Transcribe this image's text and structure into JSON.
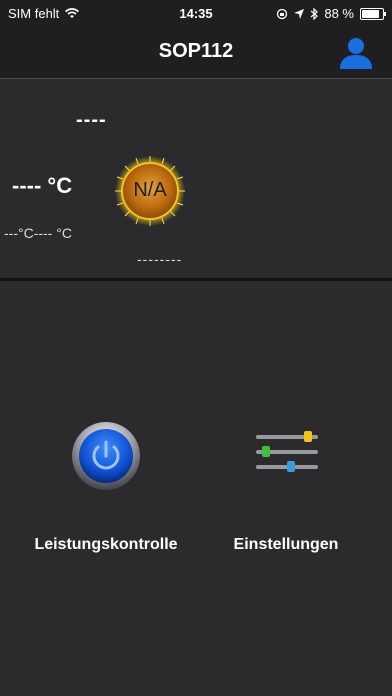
{
  "status_bar": {
    "carrier": "SIM fehlt",
    "time": "14:35",
    "battery": "88 %",
    "battery_level": 0.88
  },
  "nav": {
    "title": "SOP112",
    "user_icon": "user-icon"
  },
  "status": {
    "top_value": "----",
    "temperature": "---- °C",
    "range": "---°C---- °C",
    "bottom_value": "--------",
    "badge": "N/A"
  },
  "actions": {
    "power_label": "Leistungskontrolle",
    "settings_label": "Einstellungen"
  },
  "colors": {
    "accent": "#1a6fe0",
    "background": "#2b2b2d",
    "bar": "#1f1f21",
    "badge": "#c87a0a"
  }
}
